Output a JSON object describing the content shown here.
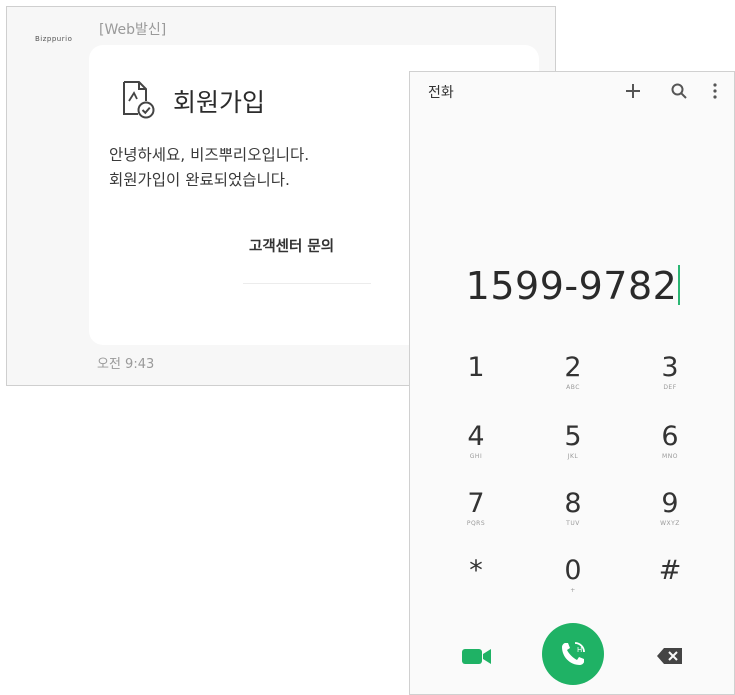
{
  "message": {
    "sender_logo": "Bizppurio",
    "tag": "[Web발신]",
    "title": "회원가입",
    "body": "안녕하세요, 비즈뿌리오입니다.\n회원가입이 완료되었습니다.",
    "link": "고객센터 문의",
    "time": "오전 9:43",
    "icon": "document-check-icon"
  },
  "dialer": {
    "title": "전화",
    "icons": [
      "plus-icon",
      "search-icon",
      "more-vert-icon"
    ],
    "number": "1599-9782",
    "keys": [
      {
        "digit": "1",
        "letters": ""
      },
      {
        "digit": "2",
        "letters": "ABC"
      },
      {
        "digit": "3",
        "letters": "DEF"
      },
      {
        "digit": "4",
        "letters": "GHI"
      },
      {
        "digit": "5",
        "letters": "JKL"
      },
      {
        "digit": "6",
        "letters": "MNO"
      },
      {
        "digit": "7",
        "letters": "PQRS"
      },
      {
        "digit": "8",
        "letters": "TUV"
      },
      {
        "digit": "9",
        "letters": "WXYZ"
      },
      {
        "digit": "*",
        "letters": ""
      },
      {
        "digit": "0",
        "letters": "+"
      },
      {
        "digit": "#",
        "letters": ""
      }
    ],
    "bottom": [
      "video-call-icon",
      "voice-call-icon",
      "backspace-icon"
    ],
    "accent_color": "#1fb265"
  }
}
